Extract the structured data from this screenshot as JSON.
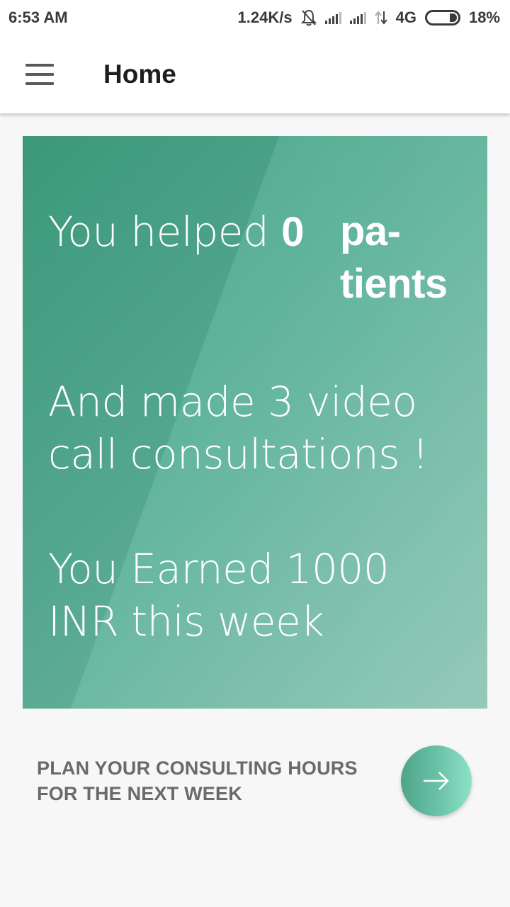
{
  "status_bar": {
    "time": "6:53 AM",
    "net_speed": "1.24K/s",
    "network_type": "4G",
    "battery": "18%",
    "icons": [
      "bell-off-icon",
      "signal-icon",
      "signal-icon",
      "data-transfer-icon",
      "battery-icon"
    ]
  },
  "app_bar": {
    "menu_icon": "hamburger-menu-icon",
    "title": "Home"
  },
  "stats": {
    "helped_prefix": "You helped",
    "patients_count": "0",
    "patients_unit": "pa- tients",
    "video_text": "And made 3 video call consultations !",
    "earned_text": "You Earned 1000 INR this week",
    "card_colors": [
      "#3fa080",
      "#86c2b0"
    ]
  },
  "plan": {
    "label": "PLAN YOUR CONSULTING HOURS FOR THE NEXT WEEK",
    "button_icon": "arrow-right-icon"
  }
}
